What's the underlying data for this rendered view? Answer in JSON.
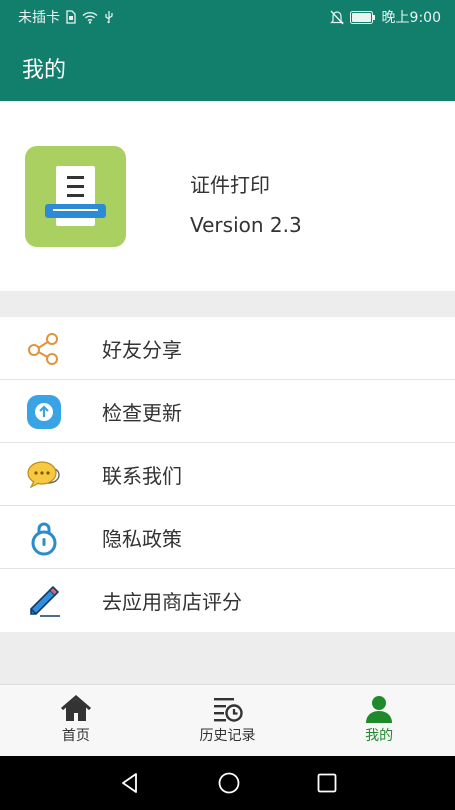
{
  "status_bar": {
    "carrier": "未插卡",
    "time": "晚上9:00"
  },
  "app_bar": {
    "title": "我的"
  },
  "profile": {
    "app_name": "证件打印",
    "version": "Version 2.3"
  },
  "menu": {
    "items": [
      {
        "label": "好友分享",
        "icon": "share-icon"
      },
      {
        "label": "检查更新",
        "icon": "update-icon"
      },
      {
        "label": "联系我们",
        "icon": "chat-icon"
      },
      {
        "label": "隐私政策",
        "icon": "lock-icon"
      },
      {
        "label": "去应用商店评分",
        "icon": "pen-icon"
      }
    ]
  },
  "bottom_nav": {
    "tabs": [
      {
        "label": "首页",
        "icon": "home-icon"
      },
      {
        "label": "历史记录",
        "icon": "history-icon"
      },
      {
        "label": "我的",
        "icon": "person-icon",
        "active": true
      }
    ]
  },
  "colors": {
    "primary": "#127f6d",
    "active_tab": "#1f8a2c",
    "app_icon_bg": "#a9d060"
  }
}
